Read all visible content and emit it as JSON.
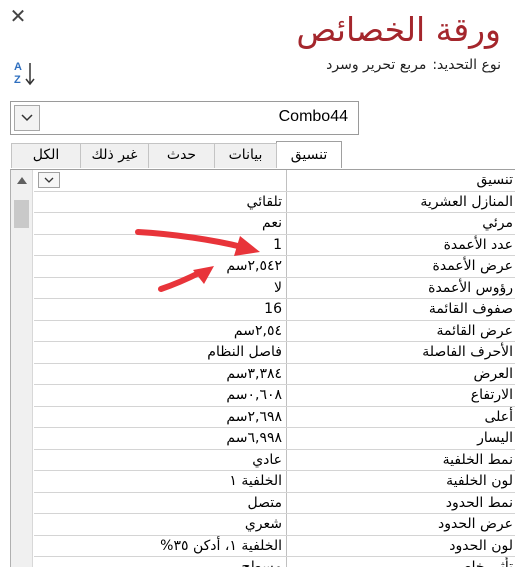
{
  "window": {
    "title": "ورقة الخصائص",
    "close_icon": "close-icon"
  },
  "selection": {
    "label": "نوع التحديد:",
    "value": "مربع تحرير وسرد"
  },
  "sort_icon": "sort-az-icon",
  "combo": {
    "value": "Combo44"
  },
  "tabs": [
    {
      "label": "تنسيق",
      "active": true
    },
    {
      "label": "بيانات",
      "active": false
    },
    {
      "label": "حدث",
      "active": false
    },
    {
      "label": "غير ذلك",
      "active": false
    },
    {
      "label": "الكل",
      "active": false
    }
  ],
  "properties": [
    {
      "name": "تنسيق",
      "value": ""
    },
    {
      "name": "المنازل العشرية",
      "value": "تلقائي"
    },
    {
      "name": "مرئي",
      "value": "نعم"
    },
    {
      "name": "عدد الأعمدة",
      "value": "1"
    },
    {
      "name": "عرض الأعمدة",
      "value": "٢,٥٤٢سم"
    },
    {
      "name": "رؤوس الأعمدة",
      "value": "لا"
    },
    {
      "name": "صفوف القائمة",
      "value": "16"
    },
    {
      "name": "عرض القائمة",
      "value": "٢,٥٤سم"
    },
    {
      "name": "الأحرف الفاصلة",
      "value": "فاصل النظام"
    },
    {
      "name": "العرض",
      "value": "٣,٣٨٤سم"
    },
    {
      "name": "الارتفاع",
      "value": "٠,٦٠٨سم"
    },
    {
      "name": "أعلى",
      "value": "٢,٦٩٨سم"
    },
    {
      "name": "اليسار",
      "value": "٦,٩٩٨سم"
    },
    {
      "name": "نمط الخلفية",
      "value": "عادي"
    },
    {
      "name": "لون الخلفية",
      "value": "الخلفية ١"
    },
    {
      "name": "نمط الحدود",
      "value": "متصل"
    },
    {
      "name": "عرض الحدود",
      "value": "شعري"
    },
    {
      "name": "لون الحدود",
      "value": "الخلفية ١، أدكن ٣٥%"
    },
    {
      "name": "تأثير خاص",
      "value": "مسطح"
    }
  ],
  "colors": {
    "title": "#a4262c",
    "annotation_arrow": "#e8343a"
  }
}
